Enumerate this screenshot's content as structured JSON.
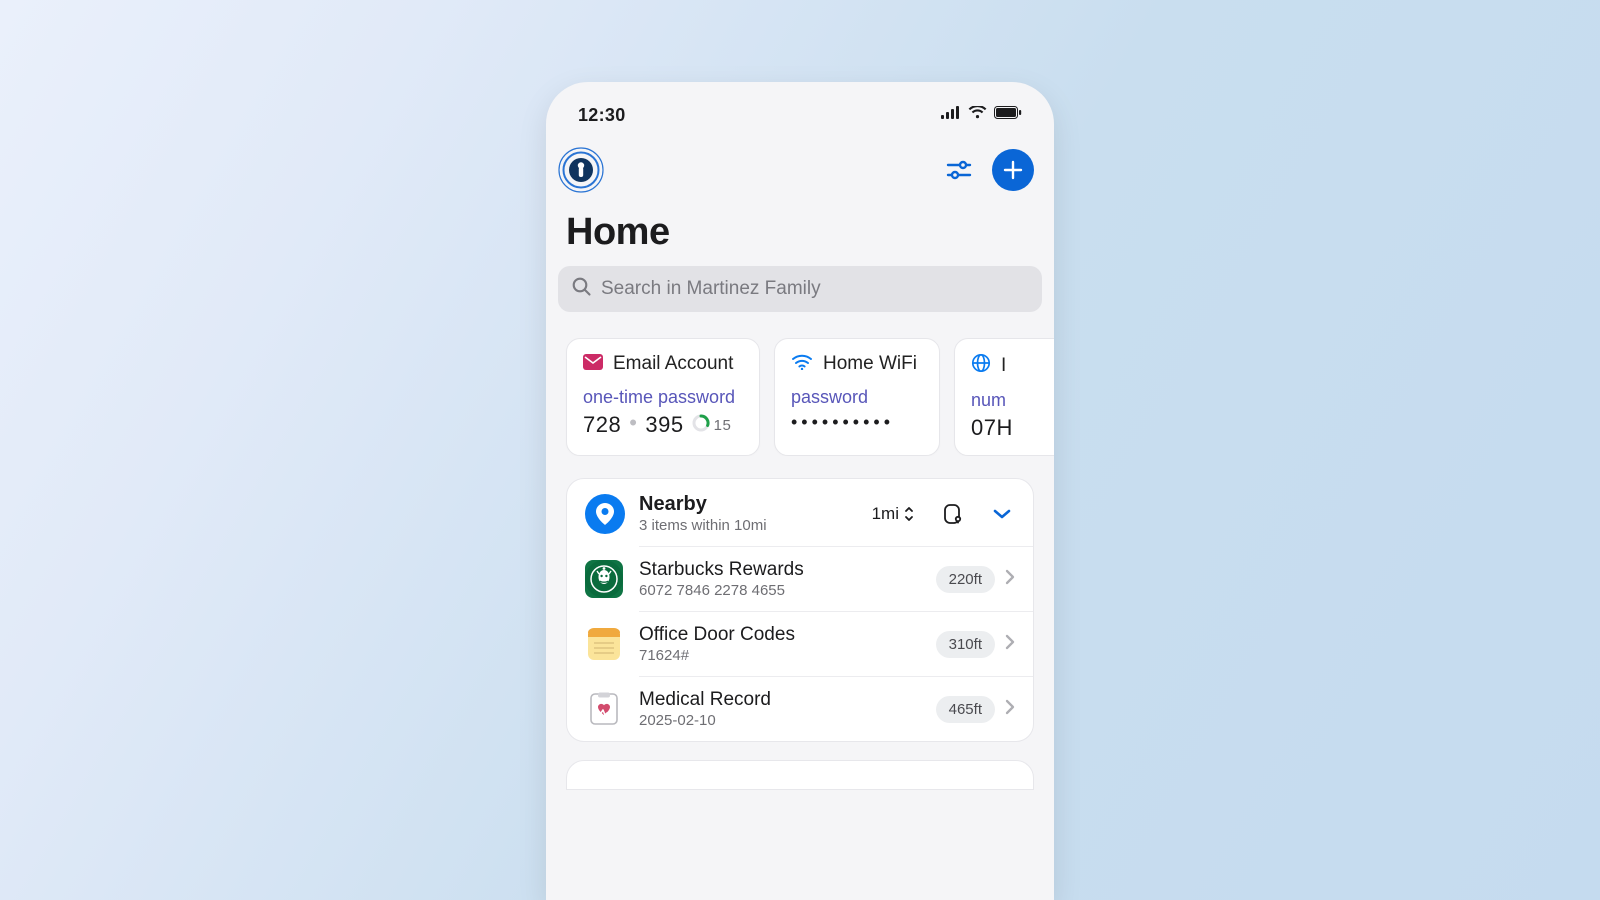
{
  "status": {
    "time": "12:30"
  },
  "header": {
    "title": "Home"
  },
  "search": {
    "placeholder": "Search in Martinez Family"
  },
  "cards": [
    {
      "title": "Email Account",
      "field_label": "one-time password",
      "otp_a": "728",
      "otp_b": "395",
      "countdown": "15"
    },
    {
      "title": "Home WiFi",
      "field_label": "password",
      "value": "••••••••••"
    },
    {
      "title": "I",
      "field_label": "num",
      "value": "07H"
    }
  ],
  "nearby": {
    "title": "Nearby",
    "subtitle": "3 items within 10mi",
    "range": "1mi",
    "items": [
      {
        "title": "Starbucks Rewards",
        "sub": "6072 7846 2278 4655",
        "dist": "220ft"
      },
      {
        "title": "Office Door Codes",
        "sub": "71624#",
        "dist": "310ft"
      },
      {
        "title": "Medical Record",
        "sub": "2025-02-10",
        "dist": "465ft"
      }
    ]
  }
}
